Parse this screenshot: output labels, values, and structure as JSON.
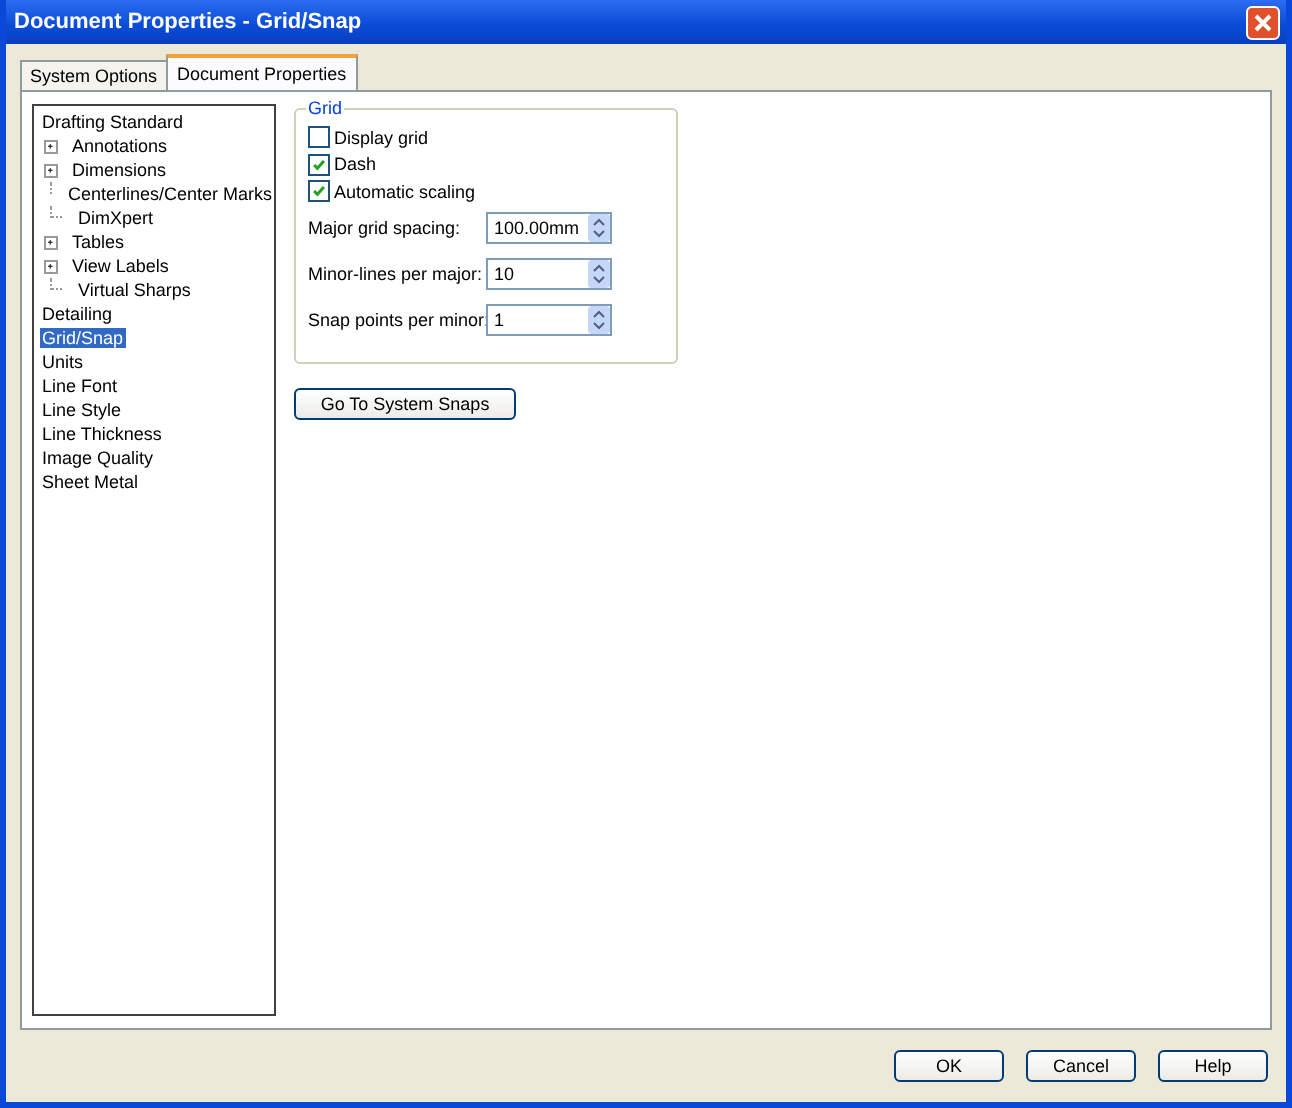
{
  "window": {
    "title": "Document Properties - Grid/Snap"
  },
  "tabs": [
    {
      "label": "System Options",
      "selected": false
    },
    {
      "label": "Document Properties",
      "selected": true
    }
  ],
  "tree": [
    {
      "label": "Drafting Standard",
      "selected": false,
      "children": [
        {
          "label": "Annotations",
          "selected": false,
          "expanded": false
        },
        {
          "label": "Dimensions",
          "selected": false,
          "expanded": false
        },
        {
          "label": "Centerlines/Center Marks",
          "selected": false
        },
        {
          "label": "DimXpert",
          "selected": false
        },
        {
          "label": "Tables",
          "selected": false,
          "expanded": false
        },
        {
          "label": "View Labels",
          "selected": false,
          "expanded": false
        },
        {
          "label": "Virtual Sharps",
          "selected": false
        }
      ]
    },
    {
      "label": "Detailing",
      "selected": false
    },
    {
      "label": "Grid/Snap",
      "selected": true
    },
    {
      "label": "Units",
      "selected": false
    },
    {
      "label": "Line Font",
      "selected": false
    },
    {
      "label": "Line Style",
      "selected": false
    },
    {
      "label": "Line Thickness",
      "selected": false
    },
    {
      "label": "Image Quality",
      "selected": false
    },
    {
      "label": "Sheet Metal",
      "selected": false
    }
  ],
  "grid_group": {
    "title": "Grid",
    "checkboxes": [
      {
        "label": "Display grid",
        "checked": false
      },
      {
        "label": "Dash",
        "checked": true
      },
      {
        "label": "Automatic scaling",
        "checked": true
      }
    ],
    "fields": [
      {
        "label": "Major grid spacing:",
        "value": "100.00mm"
      },
      {
        "label": "Minor-lines per major:",
        "value": "10"
      },
      {
        "label": "Snap points per minor:",
        "value": "1"
      }
    ]
  },
  "system_snaps_button": "Go To System Snaps",
  "buttons": [
    "OK",
    "Cancel",
    "Help"
  ]
}
